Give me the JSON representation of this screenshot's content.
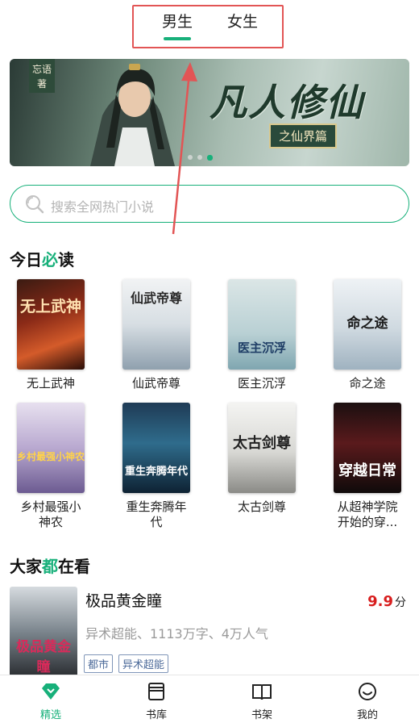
{
  "top_tabs": {
    "male": "男生",
    "female": "女生"
  },
  "banner": {
    "author_tag": "忘语\n著",
    "title": "凡人修仙",
    "subtitle": "之仙界篇"
  },
  "search": {
    "placeholder": "搜索全网热门小说"
  },
  "section_today": {
    "prefix": "今日",
    "accent": "必",
    "suffix": "读"
  },
  "today_books": [
    {
      "title": "无上武神",
      "cover_text": "无上武神"
    },
    {
      "title": "仙武帝尊",
      "cover_text": "仙武帝尊"
    },
    {
      "title": "医主沉浮",
      "cover_text": "医主沉浮"
    },
    {
      "title": "命之途",
      "cover_text": "命之途"
    },
    {
      "title": "乡村最强小神农",
      "title_display": "乡村最强小\n神农",
      "cover_text": "乡村最强小神农"
    },
    {
      "title": "重生奔腾年代",
      "title_display": "重生奔腾年\n代",
      "cover_text": "重生奔腾年代"
    },
    {
      "title": "太古剑尊",
      "cover_text": "太古剑尊"
    },
    {
      "title": "从超神学院开始的穿...",
      "title_display": "从超神学院\n开始的穿...",
      "cover_text": "穿越日常"
    }
  ],
  "section_all": {
    "prefix": "大家",
    "accent": "都",
    "suffix": "在看"
  },
  "featured": {
    "title": "极品黄金瞳",
    "meta": "异术超能、1113万字、4万人气",
    "score": "9.9",
    "score_unit": "分",
    "tags": [
      "都市",
      "异术超能"
    ],
    "cover_text": "极品黄金瞳"
  },
  "bottom_nav": [
    {
      "label": "精选",
      "icon": "gem-icon",
      "active": true
    },
    {
      "label": "书库",
      "icon": "library-icon",
      "active": false
    },
    {
      "label": "书架",
      "icon": "bookshelf-icon",
      "active": false
    },
    {
      "label": "我的",
      "icon": "smiley-icon",
      "active": false
    }
  ],
  "colors": {
    "accent": "#17b07a",
    "score": "#d81e1e",
    "annotation": "#e25555",
    "tag": "#4d6b9a"
  }
}
